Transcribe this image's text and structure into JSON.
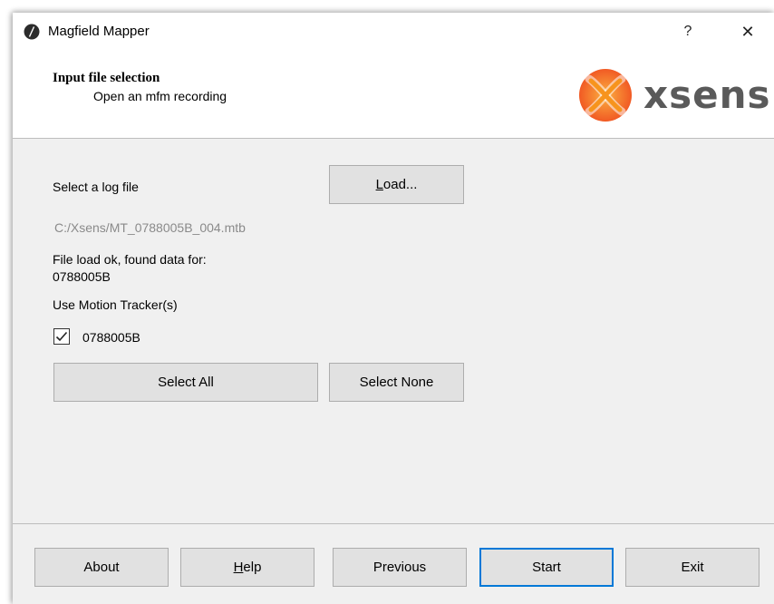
{
  "window": {
    "title": "Magfield Mapper",
    "help_label": "?",
    "close_label": "✕"
  },
  "header": {
    "title": "Input file selection",
    "subtitle": "Open an mfm recording",
    "logo_text": "xsens"
  },
  "form": {
    "select_log_label": "Select a log file",
    "load_button": {
      "accel": "L",
      "rest": "oad..."
    },
    "file_path": "C:/Xsens/MT_0788005B_004.mtb",
    "status_line1": "File load ok, found data for:",
    "status_line2": "0788005B",
    "use_trackers_label": "Use Motion Tracker(s)",
    "trackers": [
      {
        "label": "0788005B",
        "checked": true
      }
    ],
    "select_all": "Select All",
    "select_none": "Select None"
  },
  "footer": {
    "about": "About",
    "help": {
      "accel": "H",
      "rest": "elp"
    },
    "previous": "Previous",
    "start": "Start",
    "exit": "Exit"
  },
  "colors": {
    "accent": "#0078d7",
    "logo_orange": "#f7941d",
    "logo_text": "#5a5a5a"
  }
}
